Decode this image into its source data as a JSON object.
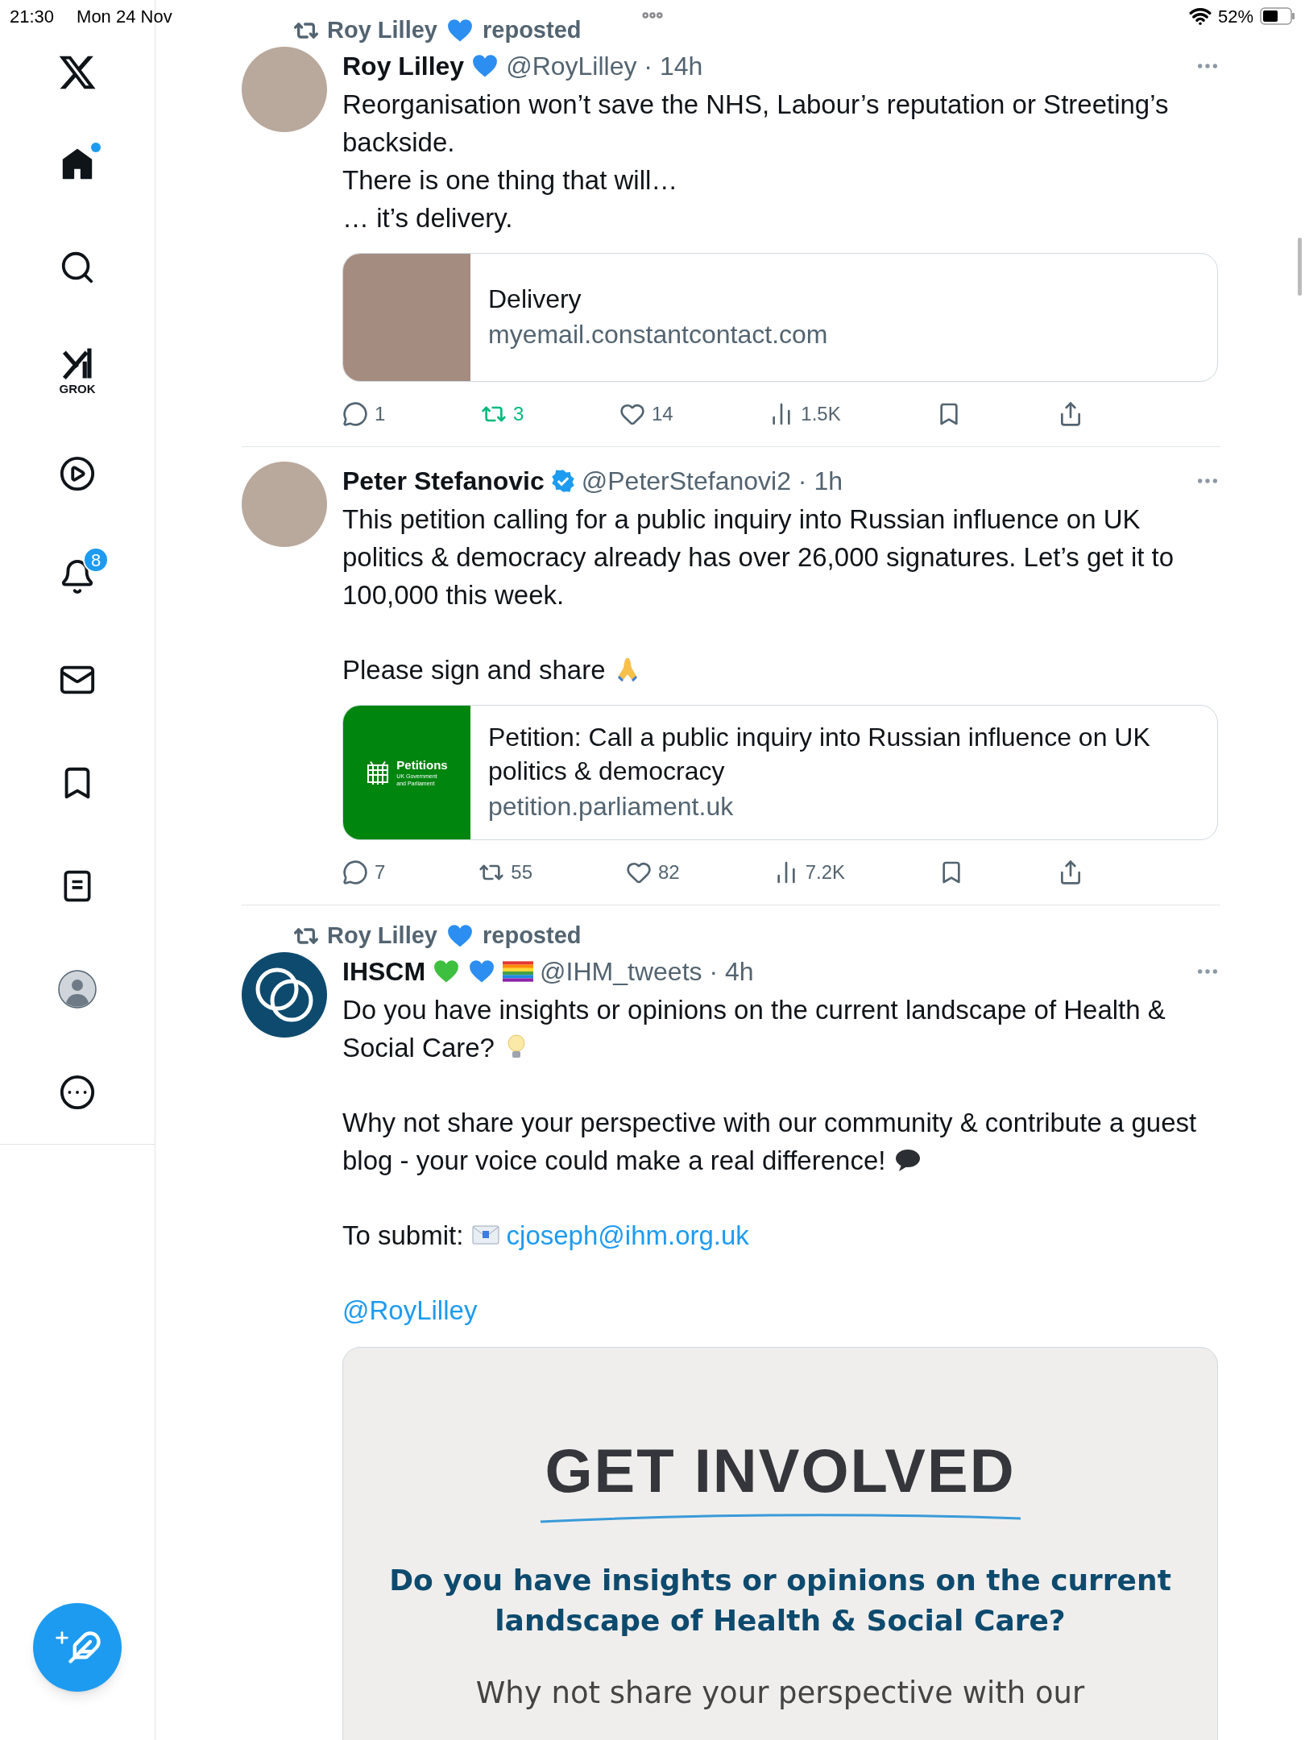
{
  "status_bar": {
    "time": "21:30",
    "date": "Mon 24 Nov",
    "battery": "52%"
  },
  "sidebar": {
    "items": [
      {
        "kind": "logo"
      },
      {
        "kind": "home",
        "selected": true,
        "has_update": true
      },
      {
        "kind": "search",
        "selected": false
      },
      {
        "kind": "grok",
        "selected": false,
        "label": "GROK"
      },
      {
        "kind": "video",
        "selected": false
      },
      {
        "kind": "notifications",
        "selected": false,
        "badge": "8"
      },
      {
        "kind": "messages",
        "selected": false
      },
      {
        "kind": "bookmarks",
        "selected": false
      },
      {
        "kind": "lists",
        "selected": false
      },
      {
        "kind": "profile",
        "selected": false
      },
      {
        "kind": "more",
        "selected": false
      }
    ]
  },
  "tweets": [
    {
      "repost": {
        "name": "Roy Lilley",
        "label": "reposted",
        "badges": [
          {
            "kind": "heart",
            "color": "#2b8ef0"
          }
        ]
      },
      "avatar": {
        "kind": "photo"
      },
      "author": "Roy Lilley",
      "badges": [
        {
          "kind": "heart",
          "color": "#2b8ef0"
        }
      ],
      "meta": "@RoyLilley · 14h",
      "paragraphs": [
        [
          [
            {
              "kind": "text",
              "text": "Reorganisation won’t save the NHS, Labour’s reputation or Streeting’s backside."
            }
          ],
          [
            {
              "kind": "text",
              "text": "There is one thing that will…"
            }
          ],
          [
            {
              "kind": "text",
              "text": "… it’s delivery."
            }
          ]
        ]
      ],
      "card": {
        "kind": "link",
        "media": {
          "kind": "photo"
        },
        "title": "Delivery",
        "domain": "myemail.constantcontact.com"
      },
      "actions": {
        "replies": "1",
        "reposts": "3",
        "reposted": true,
        "likes": "14",
        "liked": false,
        "views": "1.5K"
      }
    },
    {
      "avatar": {
        "kind": "photo"
      },
      "author": "Peter Stefanovic",
      "verified": true,
      "meta": "@PeterStefanovi2 · 1h",
      "paragraphs": [
        [
          [
            {
              "kind": "text",
              "text": "This petition calling for a public inquiry into Russian influence on UK politics & democracy already has over 26,000 signatures. Let’s get it to 100,000 this week."
            }
          ]
        ],
        [
          [
            {
              "kind": "text",
              "text": "Please sign and share "
            },
            {
              "kind": "praying-hands"
            }
          ]
        ]
      ],
      "card": {
        "kind": "link",
        "media": {
          "kind": "petitions",
          "title": "Petitions",
          "subtitle": "UK Government and Parliament"
        },
        "title": "Petition: Call a public inquiry into Russian influence on UK politics & democracy",
        "domain": "petition.parliament.uk"
      },
      "actions": {
        "replies": "7",
        "reposts": "55",
        "reposted": false,
        "likes": "82",
        "liked": false,
        "views": "7.2K"
      }
    },
    {
      "repost": {
        "name": "Roy Lilley",
        "label": "reposted",
        "badges": [
          {
            "kind": "heart",
            "color": "#2b8ef0"
          }
        ]
      },
      "avatar": {
        "kind": "logo"
      },
      "author": "IHSCM",
      "badges": [
        {
          "kind": "heart",
          "color": "#3fbf3f"
        },
        {
          "kind": "heart",
          "color": "#2b8ef0"
        },
        {
          "kind": "flag"
        }
      ],
      "meta": "@IHM_tweets · 4h",
      "paragraphs": [
        [
          [
            {
              "kind": "text",
              "text": "Do you have insights or opinions on the current landscape of Health & Social Care? "
            },
            {
              "kind": "lightbulb"
            }
          ]
        ],
        [
          [
            {
              "kind": "text",
              "text": "Why not share your perspective with our community & contribute a guest blog - your voice could make a real difference! "
            },
            {
              "kind": "speech-bubble"
            }
          ]
        ],
        [
          [
            {
              "kind": "text",
              "text": "To submit: "
            },
            {
              "kind": "envelope"
            },
            {
              "kind": "link",
              "text": "cjoseph@ihm.org.uk"
            }
          ]
        ],
        [
          [
            {
              "kind": "link",
              "text": "@RoyLilley"
            }
          ]
        ]
      ],
      "card": {
        "kind": "image",
        "heading": "GET INVOLVED",
        "subheading": "Do you have insights or opinions on the current landscape of Health & Social Care?",
        "body": "Why not share your perspective with our"
      }
    }
  ]
}
